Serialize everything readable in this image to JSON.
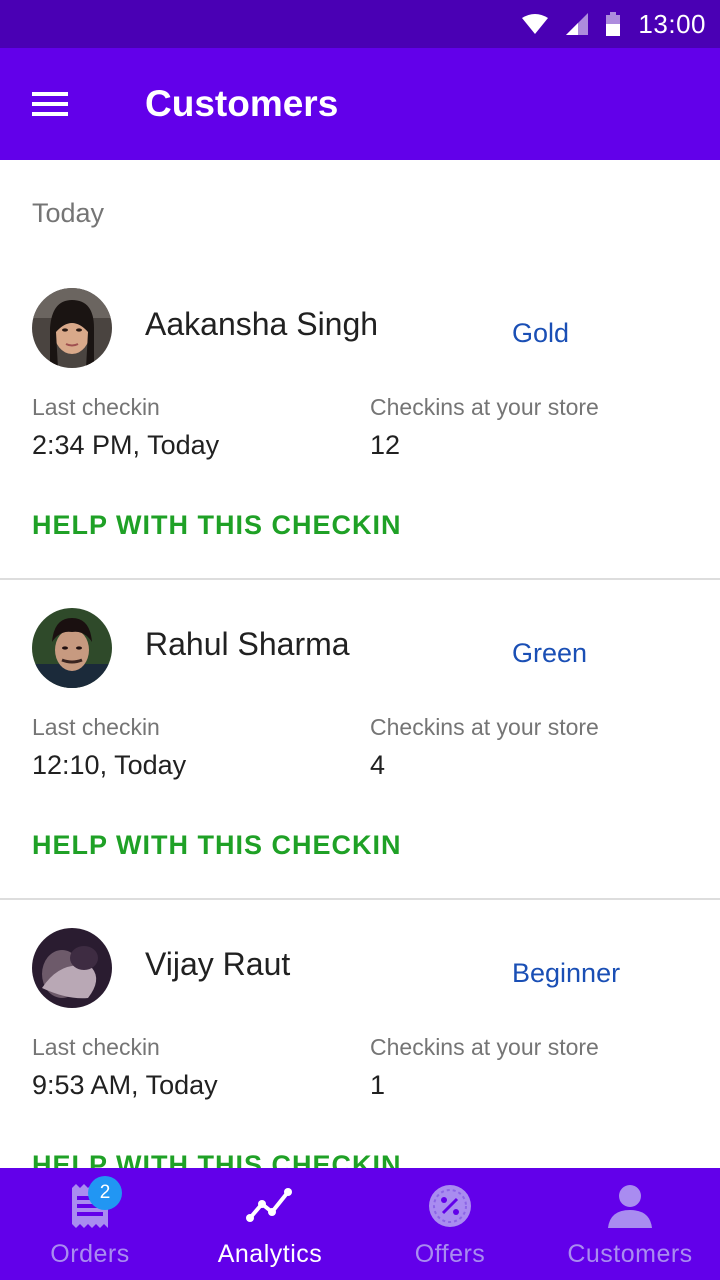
{
  "status_bar": {
    "time": "13:00",
    "icons": [
      "wifi-icon",
      "signal-icon",
      "battery-icon"
    ]
  },
  "app_bar": {
    "title": "Customers",
    "menu_icon": "menu-icon"
  },
  "section": {
    "header": "Today"
  },
  "customers": [
    {
      "name": "Aakansha Singh",
      "tier": "Gold",
      "last_checkin_label": "Last checkin",
      "last_checkin_value": "2:34 PM, Today",
      "checkins_label": "Checkins at your store",
      "checkins_value": "12",
      "help_label": "HELP WITH THIS CHECKIN"
    },
    {
      "name": "Rahul Sharma",
      "tier": "Green",
      "last_checkin_label": "Last checkin",
      "last_checkin_value": "12:10, Today",
      "checkins_label": "Checkins at your store",
      "checkins_value": "4",
      "help_label": "HELP WITH THIS CHECKIN"
    },
    {
      "name": "Vijay Raut",
      "tier": "Beginner",
      "last_checkin_label": "Last checkin",
      "last_checkin_value": "9:53 AM, Today",
      "checkins_label": "Checkins at your store",
      "checkins_value": "1",
      "help_label": "HELP WITH THIS CHECKIN"
    }
  ],
  "bottom_nav": {
    "items": [
      {
        "label": "Orders",
        "icon": "receipt-icon",
        "badge": "2",
        "active": false
      },
      {
        "label": "Analytics",
        "icon": "analytics-icon",
        "active": true
      },
      {
        "label": "Offers",
        "icon": "offer-icon",
        "active": false
      },
      {
        "label": "Customers",
        "icon": "person-icon",
        "active": false
      }
    ]
  },
  "colors": {
    "status_bar": "#4a00b4",
    "primary": "#6200ea",
    "tier_text": "#1a4fb5",
    "action_text": "#1fa126",
    "badge": "#2196f3",
    "nav_inactive": "#a98cf0"
  }
}
